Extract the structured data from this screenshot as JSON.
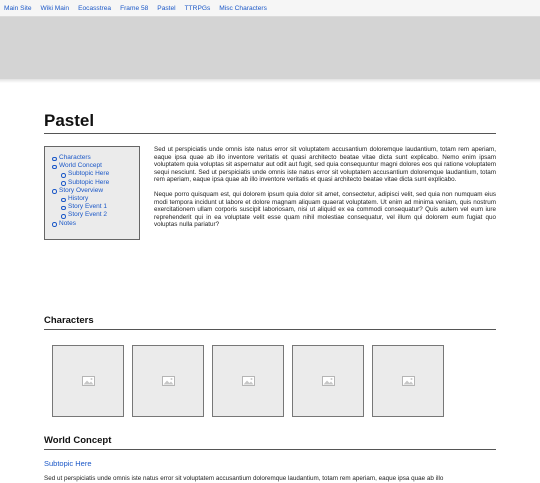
{
  "nav": {
    "items": [
      "Main Site",
      "Wiki Main",
      "Eocasstrea",
      "Frame 58",
      "Pastel",
      "TTRPGs",
      "Misc Characters"
    ]
  },
  "page": {
    "title": "Pastel"
  },
  "toc": {
    "characters": "Characters",
    "world_concept": "World Concept",
    "subtopic_1": "Subtopic Here",
    "subtopic_2": "Subtopic Here",
    "story_overview": "Story Overview",
    "history": "History",
    "story_event_1": "Story Event 1",
    "story_event_2": "Story Event 2",
    "notes": "Notes"
  },
  "intro": {
    "p1": "Sed ut perspiciatis unde omnis iste natus error sit voluptatem accusantium doloremque laudantium, totam rem aperiam, eaque ipsa quae ab illo inventore veritatis et quasi architecto beatae vitae dicta sunt explicabo. Nemo enim ipsam voluptatem quia voluptas sit aspernatur aut odit aut fugit, sed quia consequuntur magni dolores eos qui ratione voluptatem sequi nesciunt. Sed ut perspiciatis unde omnis iste natus error sit voluptatem accusantium doloremque laudantium, totam rem aperiam, eaque ipsa quae ab illo inventore veritatis et quasi architecto beatae vitae dicta sunt explicabo.",
    "p2": "Neque porro quisquam est, qui dolorem ipsum quia dolor sit amet, consectetur, adipisci velit, sed quia non numquam eius modi tempora incidunt ut labore et dolore magnam aliquam quaerat voluptatem. Ut enim ad minima veniam, quis nostrum exercitationem ullam corporis suscipit laboriosam, nisi ut aliquid ex ea commodi consequatur? Quis autem vel eum iure reprehenderit qui in ea voluptate velit esse quam nihil molestiae consequatur, vel illum qui dolorem eum fugiat quo voluptas nulla pariatur?"
  },
  "characters": {
    "title": "Characters",
    "thumbnail_icon": "image-placeholder-icon",
    "thumbnail_count": 5
  },
  "world": {
    "title": "World Concept",
    "subtopic": "Subtopic Here",
    "text": "Sed ut perspiciatis unde omnis iste natus error sit voluptatem accusantium doloremque laudantium, totam rem aperiam, eaque ipsa quae ab illo"
  },
  "colors": {
    "link": "#1a57c7",
    "banner": "#d4d4d4",
    "toc_background": "#ebebeb",
    "thumbnail_background": "#ebebeb"
  }
}
